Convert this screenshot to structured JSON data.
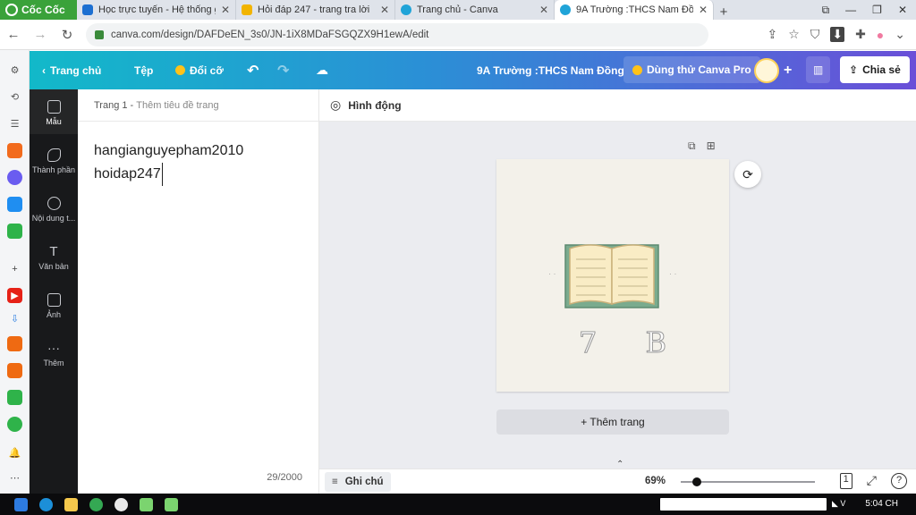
{
  "browser": {
    "brand": "Cốc Cốc",
    "tabs": [
      {
        "title": "Học trực tuyến - Hệ thống g",
        "active": false
      },
      {
        "title": "Hỏi đáp 247 - trang tra lời",
        "active": false
      },
      {
        "title": "Trang chủ - Canva",
        "active": false
      },
      {
        "title": "9A Trường :THCS Nam Đồng",
        "active": true
      }
    ],
    "new_tab": "+",
    "url": "canva.com/design/DAFDeEN_3s0/JN-1iX8MDaFSGQZX9H1ewA/edit"
  },
  "canva": {
    "header": {
      "home": "Trang chủ",
      "file": "Tệp",
      "resize": "Đổi cỡ",
      "design_title": "9A Trường :THCS Nam Đồng",
      "try_pro": "Dùng thử Canva Pro",
      "share": "Chia sẻ"
    },
    "rail": [
      {
        "label": "Mẫu",
        "icon": "template-icon"
      },
      {
        "label": "Thành phần",
        "icon": "elements-icon"
      },
      {
        "label": "Nội dung t...",
        "icon": "upload-icon"
      },
      {
        "label": "Văn bản",
        "icon": "text-icon"
      },
      {
        "label": "Ảnh",
        "icon": "photo-icon"
      },
      {
        "label": "Thêm",
        "icon": "more-icon"
      }
    ],
    "notes_panel": {
      "page_label": "Trang 1 - ",
      "page_title_placeholder": "Thêm tiêu đề trang",
      "text_line1": "hangianguyepham2010",
      "text_line2": "hoidap247",
      "counter": "29/2000"
    },
    "toolbar": {
      "animate": "Hình động"
    },
    "canvas": {
      "page_text": "7 B",
      "add_page": "+ Thêm trang"
    },
    "bottom": {
      "notes": "Ghi chú",
      "zoom": "69%",
      "zoom_level": 0.12,
      "page_count": "1"
    }
  },
  "taskbar": {
    "clock": "5:04 CH"
  },
  "colors": {
    "header_start": "#12b9c9",
    "header_end": "#6a4fd8",
    "rail_bg": "#18191b",
    "canvas_bg": "#ebecf0"
  }
}
